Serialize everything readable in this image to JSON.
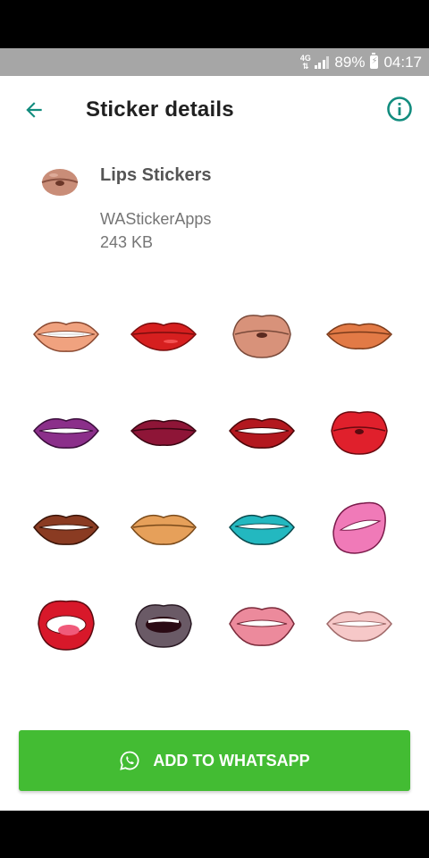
{
  "status": {
    "network": "4G",
    "battery": "89%",
    "time": "04:17"
  },
  "appbar": {
    "title": "Sticker details",
    "back_icon": "arrow-left-icon",
    "info_icon": "info-circle-icon"
  },
  "pack": {
    "name": "Lips Stickers",
    "publisher": "WAStickerApps",
    "size": "243 KB"
  },
  "stickers": [
    {
      "name": "lips-sticker-1"
    },
    {
      "name": "lips-sticker-2"
    },
    {
      "name": "lips-sticker-3"
    },
    {
      "name": "lips-sticker-4"
    },
    {
      "name": "lips-sticker-5"
    },
    {
      "name": "lips-sticker-6"
    },
    {
      "name": "lips-sticker-7"
    },
    {
      "name": "lips-sticker-8"
    },
    {
      "name": "lips-sticker-9"
    },
    {
      "name": "lips-sticker-10"
    },
    {
      "name": "lips-sticker-11"
    },
    {
      "name": "lips-sticker-12"
    },
    {
      "name": "lips-sticker-13"
    },
    {
      "name": "lips-sticker-14"
    },
    {
      "name": "lips-sticker-15"
    },
    {
      "name": "lips-sticker-16"
    }
  ],
  "add_button": {
    "label": "ADD TO WHATSAPP",
    "icon": "whatsapp-icon"
  },
  "colors": {
    "accent": "#128c7e",
    "button": "#43bc33",
    "status_bar": "#a6a6a6"
  }
}
